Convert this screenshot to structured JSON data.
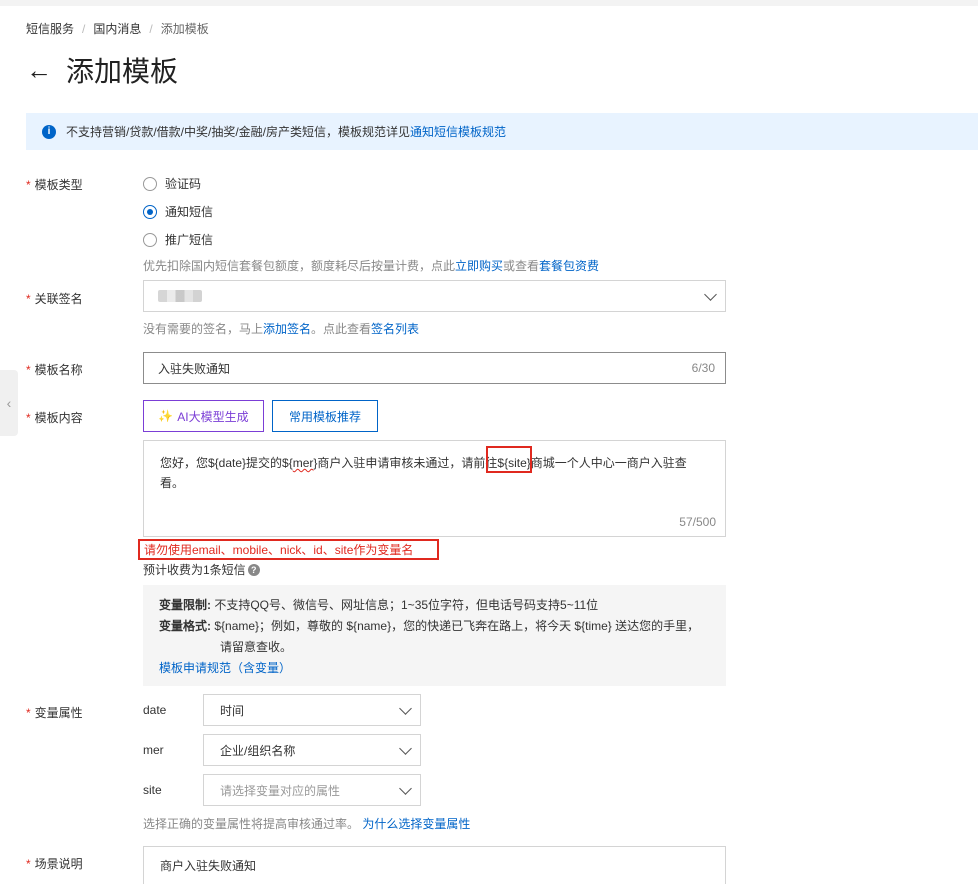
{
  "breadcrumb": {
    "items": [
      "短信服务",
      "国内消息",
      "添加模板"
    ]
  },
  "header": {
    "back": "←",
    "title": "添加模板"
  },
  "notice": {
    "icon": "info-icon",
    "text": "不支持营销/贷款/借款/中奖/抽奖/金融/房产类短信，模板规范详见",
    "link": "通知短信模板规范"
  },
  "template_type": {
    "label": "模板类型",
    "options": [
      "验证码",
      "通知短信",
      "推广短信"
    ],
    "selected": "通知短信",
    "hint_prefix": "优先扣除国内短信套餐包额度，额度耗尽后按量计费，点此",
    "hint_link1": "立即购买",
    "hint_mid": "或查看",
    "hint_link2": "套餐包资费"
  },
  "signature": {
    "label": "关联签名",
    "hint_prefix": "没有需要的签名，马上",
    "hint_link1": "添加签名",
    "hint_mid": "。点此查看",
    "hint_link2": "签名列表"
  },
  "template_name": {
    "label": "模板名称",
    "value": "入驻失败通知",
    "counter": "6/30"
  },
  "template_content": {
    "label": "模板内容",
    "ai_button": "AI大模型生成",
    "common_button": "常用模板推荐",
    "text_part1": "您好，您${date}提交的${",
    "text_squiggle": "mer",
    "text_part2": "}商户入驻申请审核未通过，请前往${site}商城一个人中心一商户入驻查看。",
    "counter": "57/500",
    "error": "请勿使用email、mobile、nick、id、site作为变量名",
    "estimate": "预计收费为1条短信"
  },
  "rules": {
    "limit_label": "变量限制:",
    "limit_text": "不支持QQ号、微信号、网址信息；1~35位字符，但电话号码支持5~11位",
    "format_label": "变量格式:",
    "format_text": "${name}；例如，尊敬的 ${name}，您的快递已飞奔在路上，将今天 ${time} 送达您的手里，",
    "format_text2": "请留意查收。",
    "link": "模板申请规范（含变量）"
  },
  "variables": {
    "label": "变量属性",
    "items": [
      {
        "name": "date",
        "value": "时间"
      },
      {
        "name": "mer",
        "value": "企业/组织名称"
      },
      {
        "name": "site",
        "value": "请选择变量对应的属性"
      }
    ],
    "hint_prefix": "选择正确的变量属性将提高审核通过率。",
    "hint_link": "为什么选择变量属性"
  },
  "scene": {
    "label": "场景说明",
    "value": "商户入驻失败通知"
  },
  "colors": {
    "primary": "#0064c8",
    "error": "#e0291f",
    "ai": "#7b3ed6",
    "notice_bg": "#e8f3ff"
  }
}
